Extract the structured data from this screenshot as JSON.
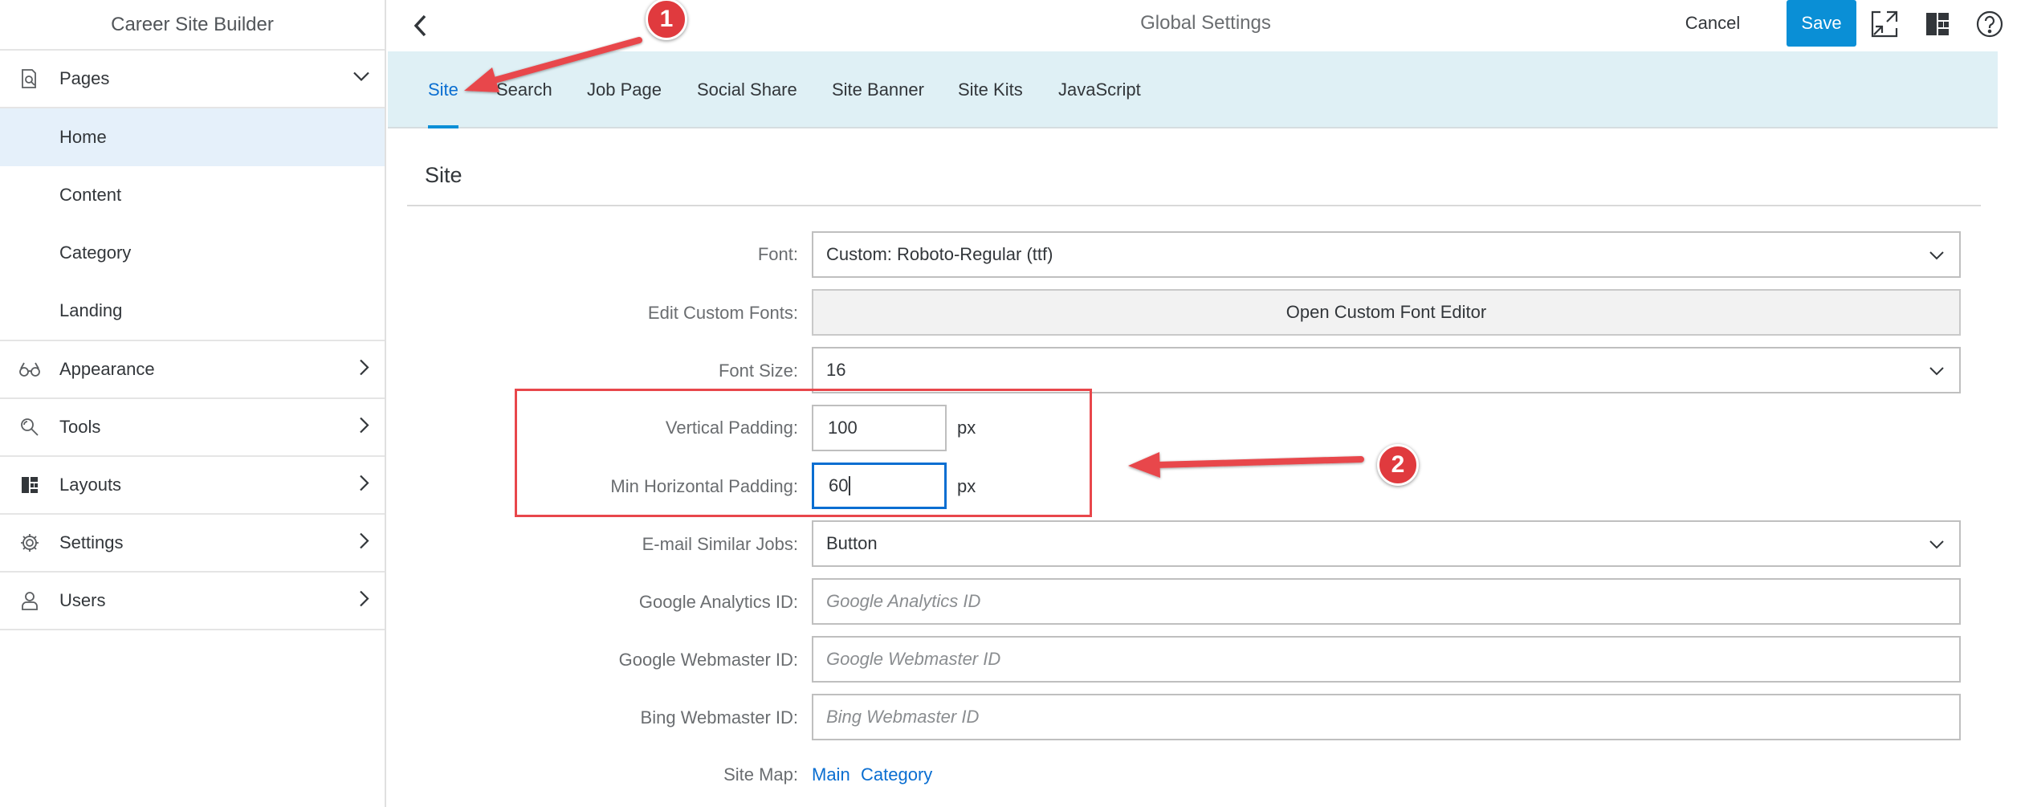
{
  "sidebar": {
    "title": "Career Site Builder",
    "pages": {
      "label": "Pages",
      "items": [
        {
          "label": "Home"
        },
        {
          "label": "Content"
        },
        {
          "label": "Category"
        },
        {
          "label": "Landing"
        }
      ]
    },
    "items": [
      {
        "label": "Appearance",
        "icon": "glasses-icon"
      },
      {
        "label": "Tools",
        "icon": "tools-icon"
      },
      {
        "label": "Layouts",
        "icon": "layout-icon"
      },
      {
        "label": "Settings",
        "icon": "gear-icon"
      },
      {
        "label": "Users",
        "icon": "user-icon"
      }
    ]
  },
  "header": {
    "title": "Global Settings",
    "cancel_label": "Cancel",
    "save_label": "Save",
    "icons": [
      "back-arrow-icon",
      "exit-fullscreen-icon",
      "layout-icon",
      "help-icon"
    ]
  },
  "tabs": [
    {
      "label": "Site",
      "active": true
    },
    {
      "label": "Search"
    },
    {
      "label": "Job Page"
    },
    {
      "label": "Social Share"
    },
    {
      "label": "Site Banner"
    },
    {
      "label": "Site Kits"
    },
    {
      "label": "JavaScript"
    }
  ],
  "section": {
    "title": "Site",
    "fields": {
      "font": {
        "label": "Font:",
        "value": "Custom: Roboto-Regular (ttf)"
      },
      "custom_fonts": {
        "label": "Edit Custom Fonts:",
        "button": "Open Custom Font Editor"
      },
      "font_size": {
        "label": "Font Size:",
        "value": "16"
      },
      "vertical_padding": {
        "label": "Vertical Padding:",
        "value": "100",
        "unit": "px"
      },
      "min_horizontal_padding": {
        "label": "Min Horizontal Padding:",
        "value": "60",
        "unit": "px"
      },
      "email_similar_jobs": {
        "label": "E-mail Similar Jobs:",
        "value": "Button"
      },
      "google_analytics": {
        "label": "Google Analytics ID:",
        "placeholder": "Google Analytics ID"
      },
      "google_webmaster": {
        "label": "Google Webmaster ID:",
        "placeholder": "Google Webmaster ID"
      },
      "bing_webmaster": {
        "label": "Bing Webmaster ID:",
        "placeholder": "Bing Webmaster ID"
      },
      "site_map": {
        "label": "Site Map:",
        "links": [
          "Main",
          "Category"
        ]
      }
    }
  },
  "annotations": {
    "badge1": "1",
    "badge2": "2",
    "color": "#e8474b"
  },
  "colors": {
    "accent": "#0a8fd6",
    "tab_bar": "#dff0f5",
    "active_item": "#e5f0fa",
    "link": "#0a6ed1"
  }
}
